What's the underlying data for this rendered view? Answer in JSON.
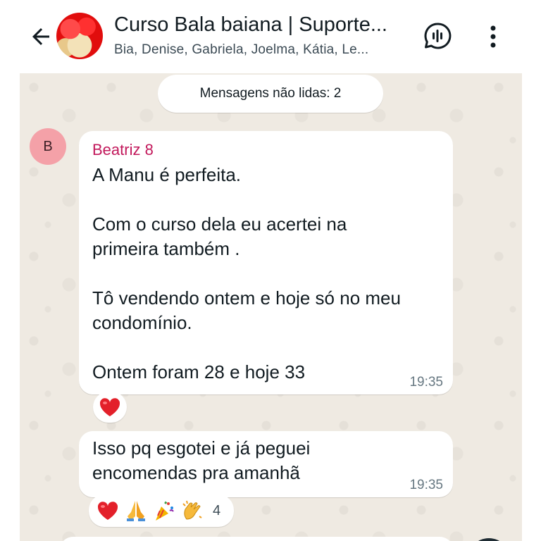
{
  "header": {
    "title": "Curso Bala baiana | Suporte...",
    "subtitle": "Bia, Denise, Gabriela, Joelma, Kátia, Le..."
  },
  "chat": {
    "unread_label": "Mensagens não lidas: 2",
    "messages": [
      {
        "avatar_letter": "B",
        "sender": "Beatriz 8",
        "text": "A Manu é perfeita.\n\nCom o curso dela eu acertei na primeira também .\n\nTô vendendo ontem e hoje só no meu condomínio.\n\nOntem foram 28 e hoje 33",
        "time": "19:35",
        "reactions": [
          "heart"
        ]
      },
      {
        "text": "Isso pq esgotei e já peguei encomendas pra amanhã",
        "time": "19:35",
        "reactions": [
          "heart",
          "folded-hands",
          "party-popper",
          "clapping-hands"
        ],
        "reaction_count": "4"
      }
    ]
  },
  "colors": {
    "chat_background": "#efeae2",
    "sender_name": "#c2185b",
    "avatar_bg": "#f4a1a8"
  }
}
